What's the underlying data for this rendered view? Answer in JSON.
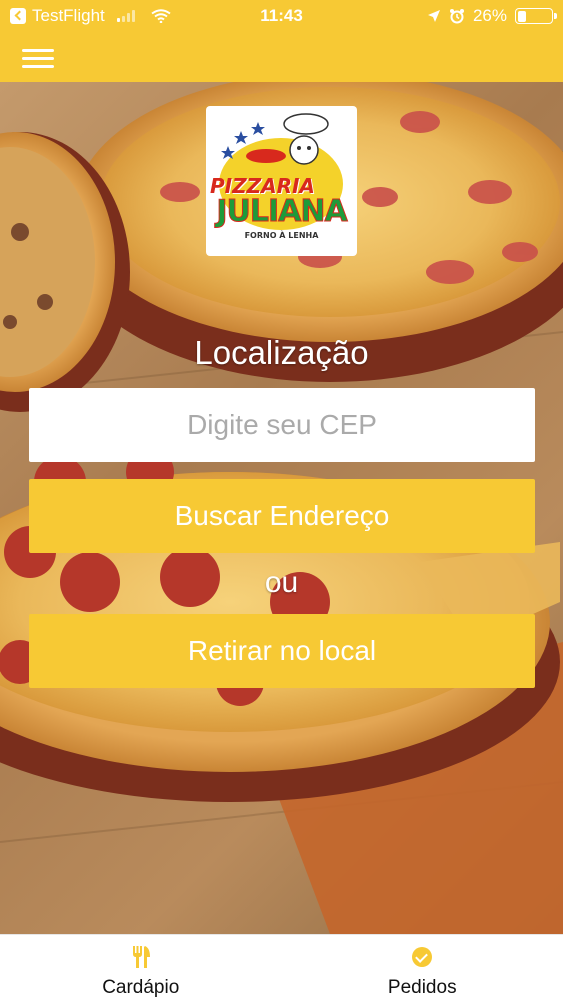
{
  "status_bar": {
    "carrier": "TestFlight",
    "time": "11:43",
    "battery": "26%",
    "battery_level": 0.26
  },
  "logo": {
    "line1": "PIZZARIA",
    "line2": "JULIANA",
    "line3": "FORNO À LENHA"
  },
  "location": {
    "title": "Localização",
    "cep_placeholder": "Digite seu CEP",
    "search_button": "Buscar Endereço",
    "or_label": "ou",
    "pickup_button": "Retirar no local"
  },
  "tabs": [
    {
      "label": "Cardápio",
      "icon": "fork-knife-icon"
    },
    {
      "label": "Pedidos",
      "icon": "check-circle-icon"
    }
  ],
  "colors": {
    "accent": "#f7c934",
    "tab_icon": "#f7c934"
  }
}
